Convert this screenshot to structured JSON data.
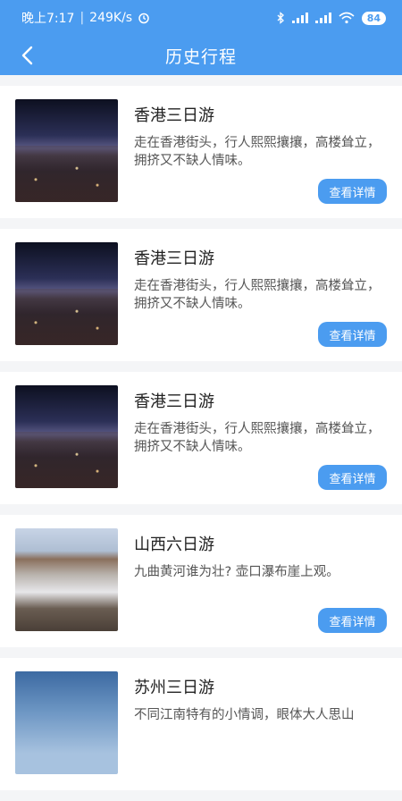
{
  "status": {
    "time": "晚上7:17",
    "speed": "249K/s",
    "battery": "84"
  },
  "nav": {
    "title": "历史行程"
  },
  "colors": {
    "accent": "#4b9cf0"
  },
  "trips": [
    {
      "title": "香港三日游",
      "desc": "走在香港街头，行人熙熙攘攘，高楼耸立，拥挤又不缺人情味。",
      "button": "查看详情",
      "image": "city-night"
    },
    {
      "title": "香港三日游",
      "desc": "走在香港街头，行人熙熙攘攘，高楼耸立，拥挤又不缺人情味。",
      "button": "查看详情",
      "image": "city-night"
    },
    {
      "title": "香港三日游",
      "desc": "走在香港街头，行人熙熙攘攘，高楼耸立，拥挤又不缺人情味。",
      "button": "查看详情",
      "image": "city-night"
    },
    {
      "title": "山西六日游",
      "desc": "九曲黄河谁为壮? 壶口瀑布崖上观。",
      "button": "查看详情",
      "image": "waterfall"
    },
    {
      "title": "苏州三日游",
      "desc": "不同江南特有的小情调，眼体大人思山",
      "button": "",
      "image": "sky"
    }
  ]
}
